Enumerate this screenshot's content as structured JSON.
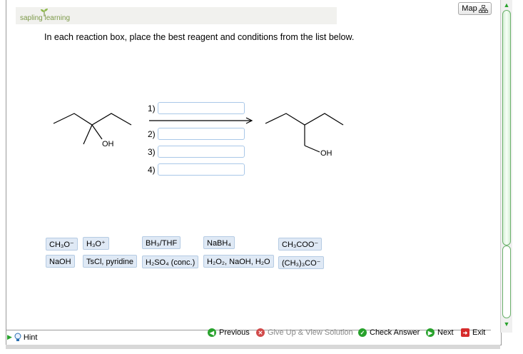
{
  "logo": {
    "text": "sapling learning"
  },
  "map_button": {
    "label": "Map"
  },
  "question": {
    "prompt": "In each reaction box, place the best reagent and conditions from the list below."
  },
  "reaction": {
    "start_oh": "OH",
    "product_oh": "OH",
    "steps": [
      "1)",
      "2)",
      "3)",
      "4)"
    ]
  },
  "reagents": [
    {
      "label": "CH₃O⁻"
    },
    {
      "label": "H₃O⁺"
    },
    {
      "label": "BH₃/THF"
    },
    {
      "label": "NaBH₄"
    },
    {
      "label": "CH₃COO⁻"
    },
    {
      "label": "NaOH"
    },
    {
      "label": "TsCl, pyridine"
    },
    {
      "label": "H₂SO₄ (conc.)"
    },
    {
      "label": "H₂O₂, NaOH, H₂O"
    },
    {
      "label": "(CH₃)₃CO⁻"
    }
  ],
  "footer": {
    "hint": "Hint",
    "previous": "Previous",
    "give_up": "Give Up & View Solution",
    "check": "Check Answer",
    "next": "Next",
    "exit": "Exit"
  },
  "colors": {
    "accent_green": "#28a22c",
    "reagent_bg": "#dfe9f5",
    "slot_border": "#a9c8e8",
    "exit_red": "#d62b2b"
  },
  "icons": [
    "sprout-icon",
    "map-icon",
    "hint-bulb-icon",
    "previous-arrow-icon",
    "give-up-icon",
    "check-icon",
    "next-arrow-icon",
    "exit-icon"
  ]
}
